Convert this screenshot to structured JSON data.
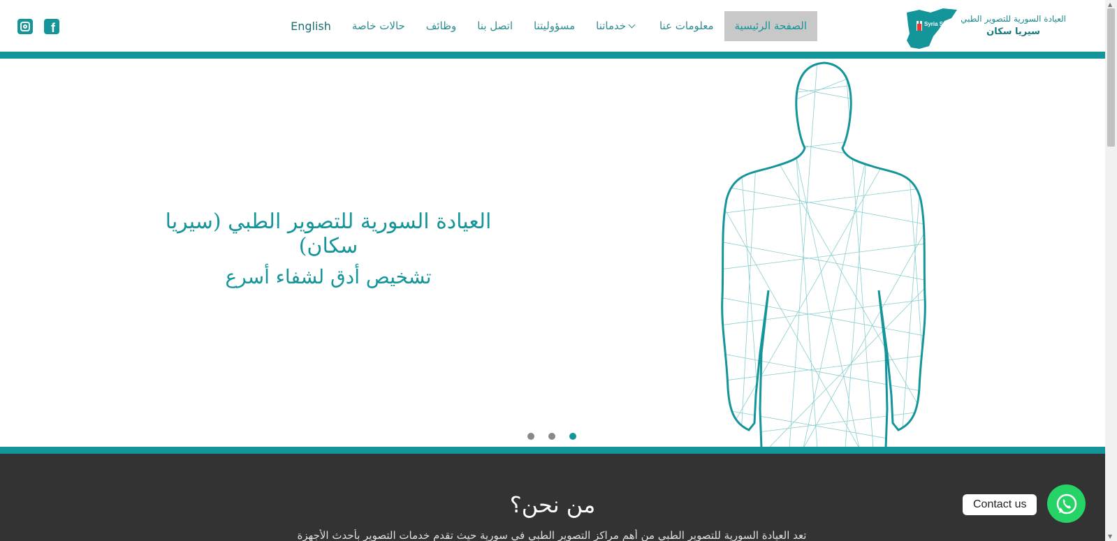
{
  "theme": {
    "accent": "#14959a",
    "dark": "#333333",
    "whatsapp": "#25d366"
  },
  "header": {
    "logo": {
      "line1": "العيادة السورية للتصوير الطبي",
      "line2": "سيريا سكان",
      "brand": "Syria Scan"
    },
    "nav": [
      {
        "label": "الصفحة الرئيسية",
        "active": true
      },
      {
        "label": "معلومات عنا"
      },
      {
        "label": "خدماتنا",
        "dropdown": true
      },
      {
        "label": "مسؤوليتنا"
      },
      {
        "label": "اتصل بنا"
      },
      {
        "label": "وظائف"
      },
      {
        "label": "حالات خاصة"
      },
      {
        "label": "English"
      }
    ],
    "social": [
      "facebook-icon",
      "instagram-icon"
    ]
  },
  "hero": {
    "title": "العيادة السورية للتصوير الطبي (سيريا سكان)",
    "subtitle": "تشخيص أدق لشفاء أسرع",
    "slide_count": 3,
    "active_slide": 3
  },
  "about": {
    "title": "من نحن؟",
    "text": "تعد العيادة السورية للتصوير الطبي من أهم مراكز التصوير الطبي في سورية حيث تقدم خدمات التصوير بأحدث الأجهزة"
  },
  "contact": {
    "label": "Contact us"
  }
}
